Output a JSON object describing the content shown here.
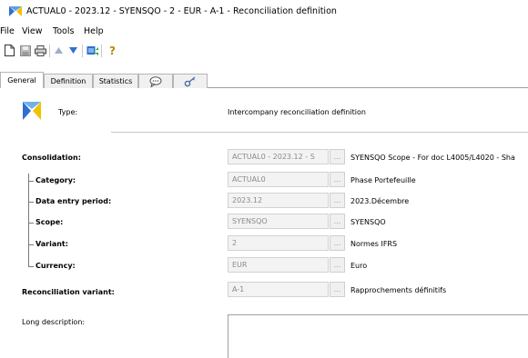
{
  "window": {
    "title": "ACTUAL0 - 2023.12 - SYENSQO - 2 - EUR - A-1 - Reconciliation definition"
  },
  "menu": {
    "items": [
      "File",
      "View",
      "Tools",
      "Help"
    ]
  },
  "toolbar": {
    "icons": [
      "new-document-icon",
      "save-icon",
      "print-icon",
      "up-arrow-icon",
      "down-arrow-icon",
      "export-icon",
      "help-icon"
    ]
  },
  "tabs": {
    "general": "General",
    "definition": "Definition",
    "statistics": "Statistics"
  },
  "form": {
    "type_label": "Type:",
    "type_value": "Intercompany reconciliation definition",
    "consolidation": {
      "label": "Consolidation:",
      "value": "ACTUAL0 - 2023.12 - S",
      "desc": "SYENSQO Scope - For doc L4005/L4020 - Sha"
    },
    "category": {
      "label": "Category:",
      "value": "ACTUAL0",
      "desc": "Phase Portefeuille"
    },
    "period": {
      "label": "Data entry period:",
      "value": "2023.12",
      "desc": "2023.Décembre"
    },
    "scope": {
      "label": "Scope:",
      "value": "SYENSQO",
      "desc": "SYENSQO"
    },
    "variant": {
      "label": "Variant:",
      "value": "2",
      "desc": "Normes IFRS"
    },
    "currency": {
      "label": "Currency:",
      "value": "EUR",
      "desc": "Euro"
    },
    "recon_variant": {
      "label": "Reconciliation variant:",
      "value": "A-1",
      "desc": "Rapprochements définitifs"
    },
    "long_desc_label": "Long description:",
    "browse": "..."
  },
  "colors": {
    "accent_yellow": "#f2c200",
    "accent_blue": "#2f6fcf"
  }
}
